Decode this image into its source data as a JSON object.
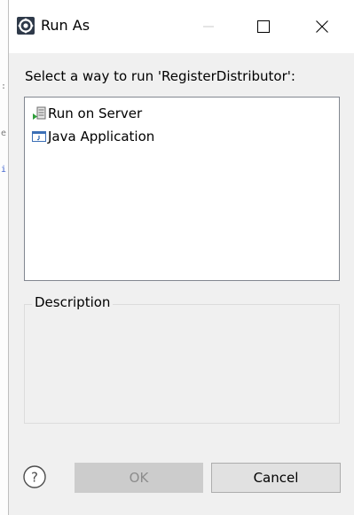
{
  "window": {
    "title": "Run As",
    "icon": "run-as-app-icon",
    "controls": {
      "minimize_icon": "minimize-icon",
      "maximize_icon": "maximize-icon",
      "close_icon": "close-icon"
    }
  },
  "prompt": "Select a way to run 'RegisterDistributor':",
  "launch_options": [
    {
      "label": "Run on Server",
      "icon": "server-icon"
    },
    {
      "label": "Java Application",
      "icon": "java-application-icon"
    }
  ],
  "description": {
    "label": "Description",
    "text": ""
  },
  "buttons": {
    "help_icon": "help-icon",
    "ok_label": "OK",
    "ok_enabled": false,
    "cancel_label": "Cancel"
  },
  "colors": {
    "dialog_bg": "#f0f0f0",
    "titlebar_bg": "#ffffff",
    "disabled_button_bg": "#cccccc",
    "disabled_button_text": "#8c8c8c",
    "button_bg": "#e1e1e1"
  }
}
